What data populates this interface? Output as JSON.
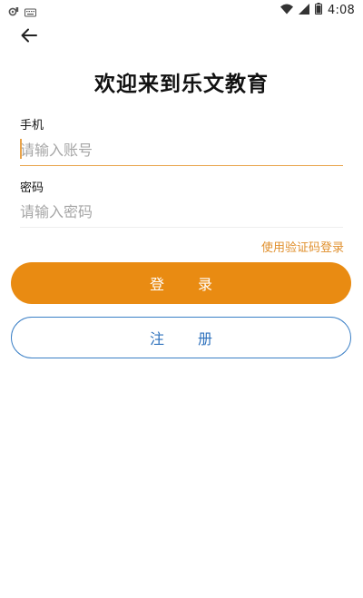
{
  "status_bar": {
    "time": "4:08",
    "left_icons": [
      "gear-notification-icon",
      "keyboard-icon"
    ],
    "right_icons": [
      "wifi-icon",
      "signal-icon",
      "battery-icon"
    ]
  },
  "header": {
    "back_icon": "arrow-left-icon",
    "title": "欢迎来到乐文教育"
  },
  "form": {
    "phone_label": "手机",
    "phone_placeholder": "请输入账号",
    "password_label": "密码",
    "password_placeholder": "请输入密码",
    "sms_login_link": "使用验证码登录"
  },
  "actions": {
    "login_label": "登 录",
    "register_label": "注 册"
  },
  "colors": {
    "accent_orange": "#e98b12",
    "link_orange": "#e0902e",
    "register_blue": "#3a7fc6",
    "input_focus_underline": "#e8a34a"
  }
}
